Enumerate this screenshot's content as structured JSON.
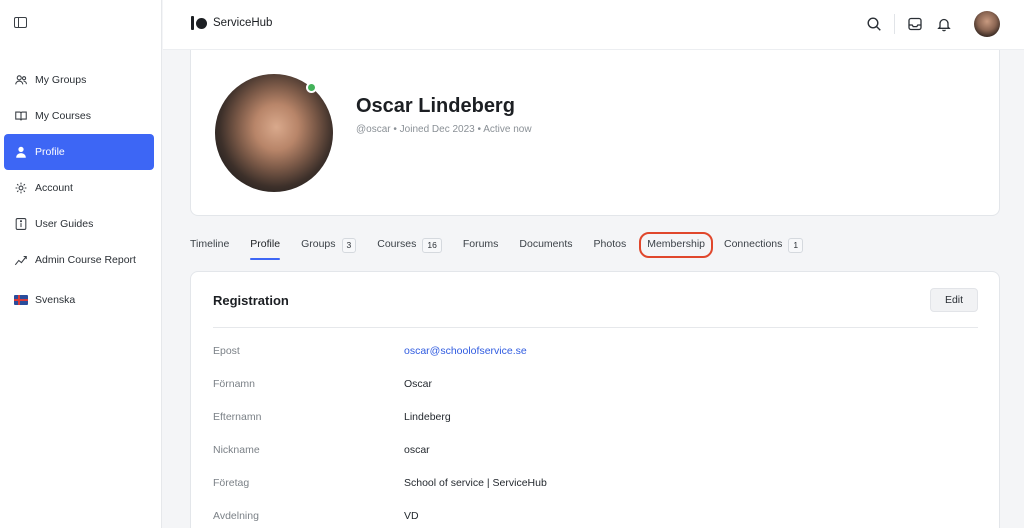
{
  "app": {
    "name": "ServiceHub"
  },
  "sidebar": {
    "items": [
      {
        "label": "My Groups",
        "icon": "users-icon",
        "active": false
      },
      {
        "label": "My Courses",
        "icon": "book-icon",
        "active": false
      },
      {
        "label": "Profile",
        "icon": "user-icon",
        "active": true
      },
      {
        "label": "Account",
        "icon": "gear-icon",
        "active": false
      },
      {
        "label": "User Guides",
        "icon": "info-icon",
        "active": false
      },
      {
        "label": "Admin Course Report",
        "icon": "chart-line-icon",
        "active": false
      }
    ],
    "language": {
      "label": "Svenska",
      "icon": "sweden-flag-icon"
    }
  },
  "profile": {
    "name": "Oscar Lindeberg",
    "meta": "@oscar • Joined Dec 2023 • Active now",
    "online": true
  },
  "tabs": [
    {
      "label": "Timeline",
      "count": null
    },
    {
      "label": "Profile",
      "count": null,
      "active": true
    },
    {
      "label": "Groups",
      "count": "3"
    },
    {
      "label": "Courses",
      "count": "16"
    },
    {
      "label": "Forums",
      "count": null
    },
    {
      "label": "Documents",
      "count": null
    },
    {
      "label": "Photos",
      "count": null
    },
    {
      "label": "Membership",
      "count": null,
      "highlighted": true
    },
    {
      "label": "Connections",
      "count": "1"
    }
  ],
  "registration": {
    "title": "Registration",
    "edit_label": "Edit",
    "fields": [
      {
        "label": "Epost",
        "value": "oscar@schoolofservice.se"
      },
      {
        "label": "Förnamn",
        "value": "Oscar"
      },
      {
        "label": "Efternamn",
        "value": "Lindeberg"
      },
      {
        "label": "Nickname",
        "value": "oscar"
      },
      {
        "label": "Företag",
        "value": "School of service | ServiceHub"
      },
      {
        "label": "Avdelning",
        "value": "VD"
      }
    ]
  },
  "colors": {
    "accent": "#3d66f5",
    "highlight": "#e0472c",
    "online": "#43b25a",
    "link": "#2f5be0"
  }
}
